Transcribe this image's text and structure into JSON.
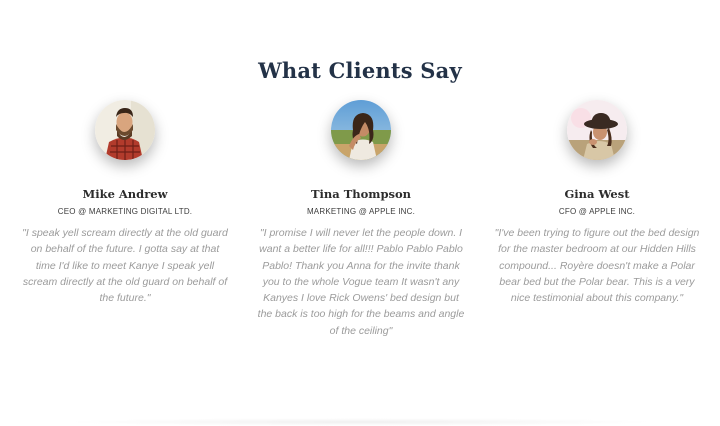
{
  "section": {
    "title": "What Clients Say"
  },
  "testimonials": [
    {
      "name": "Mike Andrew",
      "role": "CEO @ MARKETING DIGITAL LTD.",
      "quote": "\"I speak yell scream directly at the old guard on behalf of the future. I gotta say at that time I'd like to meet Kanye I speak yell scream directly at the old guard on behalf of the future.\"",
      "avatar_icon": "person-photo-avatar"
    },
    {
      "name": "Tina Thompson",
      "role": "MARKETING @ APPLE INC.",
      "quote": "\"I promise I will never let the people down. I want a better life for all!!! Pablo Pablo Pablo Pablo! Thank you Anna for the invite thank you to the whole Vogue team It wasn't any Kanyes I love Rick Owens' bed design but the back is too high for the beams and angle of the ceiling\"",
      "avatar_icon": "person-photo-avatar"
    },
    {
      "name": "Gina West",
      "role": "CFO @ APPLE INC.",
      "quote": "\"I've been trying to figure out the bed design for the master bedroom at our Hidden Hills compound... Royère doesn't make a Polar bear bed but the Polar bear. This is a very nice testimonial about this company.\"",
      "avatar_icon": "person-photo-avatar"
    }
  ],
  "colors": {
    "title": "#233247",
    "name": "#2c2c2c",
    "quote": "#9b9b9b"
  }
}
